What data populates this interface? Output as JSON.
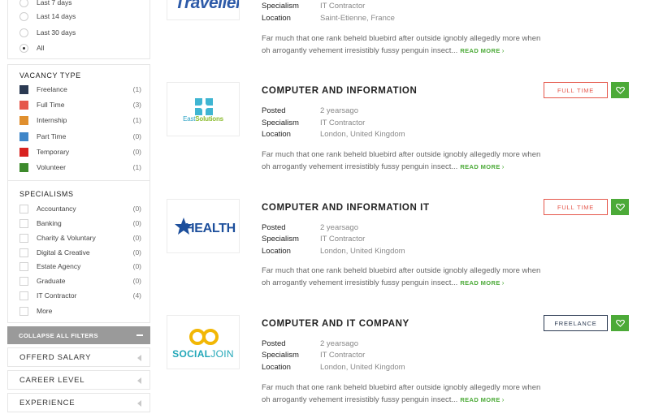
{
  "sidebar": {
    "date_posted": [
      {
        "label": "Last 7 days",
        "checked": false
      },
      {
        "label": "Last 14 days",
        "checked": false
      },
      {
        "label": "Last 30 days",
        "checked": false
      },
      {
        "label": "All",
        "checked": true
      }
    ],
    "vacancy_type": {
      "heading": "VACANCY TYPE",
      "items": [
        {
          "label": "Freelance",
          "count": "(1)",
          "color": "#2b3a52"
        },
        {
          "label": "Full Time",
          "count": "(3)",
          "color": "#e5574b"
        },
        {
          "label": "Internship",
          "count": "(1)",
          "color": "#e08f2e"
        },
        {
          "label": "Part Time",
          "count": "(0)",
          "color": "#3f86c8"
        },
        {
          "label": "Temporary",
          "count": "(0)",
          "color": "#d8221f"
        },
        {
          "label": "Volunteer",
          "count": "(1)",
          "color": "#3d8a2c"
        }
      ]
    },
    "specialisms": {
      "heading": "SPECIALISMS",
      "items": [
        {
          "label": "Accountancy",
          "count": "(0)"
        },
        {
          "label": "Banking",
          "count": "(0)"
        },
        {
          "label": "Charity & Voluntary",
          "count": "(0)"
        },
        {
          "label": "Digital & Creative",
          "count": "(0)"
        },
        {
          "label": "Estate Agency",
          "count": "(0)"
        },
        {
          "label": "Graduate",
          "count": "(0)"
        },
        {
          "label": "IT Contractor",
          "count": "(4)"
        }
      ],
      "more_label": "More"
    },
    "collapse_label": "COLLAPSE ALL FILTERS",
    "accordions": [
      "OFFERD SALARY",
      "CAREER LEVEL",
      "EXPERIENCE"
    ]
  },
  "jobs": [
    {
      "title": "",
      "logo_text": "Traveller",
      "specialism_label": "Specialism",
      "specialism": "IT Contractor",
      "location_label": "Location",
      "location": "Saint-Etienne, France",
      "desc_line1": "Far much that one rank beheld bluebird after outside ignobly allegedly more when",
      "desc_line2": "oh arrogantly vehement irresistibly fussy penguin insect...",
      "read_more": "READ MORE"
    },
    {
      "title": "COMPUTER AND INFORMATION",
      "badge": "FULL TIME",
      "logo_text_a": "East",
      "logo_text_b": "Solutions",
      "posted_label": "Posted",
      "posted": "2 yearsago",
      "specialism_label": "Specialism",
      "specialism": "IT Contractor",
      "location_label": "Location",
      "location": "London, United Kingdom",
      "desc_line1": "Far much that one rank beheld bluebird after outside ignobly allegedly more when",
      "desc_line2": "oh arrogantly vehement irresistibly fussy penguin insect...",
      "read_more": "READ MORE"
    },
    {
      "title": "COMPUTER AND INFORMATION IT",
      "badge": "FULL TIME",
      "logo_text": "HEALTH",
      "posted_label": "Posted",
      "posted": "2 yearsago",
      "specialism_label": "Specialism",
      "specialism": "IT Contractor",
      "location_label": "Location",
      "location": "London, United Kingdom",
      "desc_line1": "Far much that one rank beheld bluebird after outside ignobly allegedly more when",
      "desc_line2": "oh arrogantly vehement irresistibly fussy penguin insect...",
      "read_more": "READ MORE"
    },
    {
      "title": "COMPUTER AND IT COMPANY",
      "badge": "FREELANCE",
      "logo_text_a": "SOCIAL",
      "logo_text_b": "JOIN",
      "posted_label": "Posted",
      "posted": "2 yearsago",
      "specialism_label": "Specialism",
      "specialism": "IT Contractor",
      "location_label": "Location",
      "location": "London, United Kingdom",
      "desc_line1": "Far much that one rank beheld bluebird after outside ignobly allegedly more when",
      "desc_line2": "oh arrogantly vehement irresistibly fussy penguin insect...",
      "read_more": "READ MORE"
    }
  ],
  "colors": {
    "accent_green": "#4caa38",
    "full_time_red": "#e5574b",
    "freelance_navy": "#2b3a52"
  }
}
